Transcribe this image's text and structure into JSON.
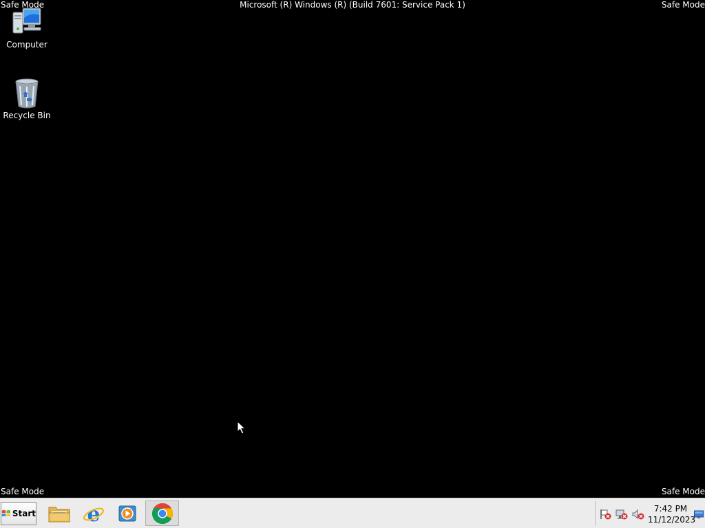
{
  "overlay": {
    "safe_mode": "Safe Mode",
    "build_info": "Microsoft (R) Windows (R) (Build 7601: Service Pack 1)"
  },
  "desktop_icons": [
    {
      "label": "Computer",
      "icon": "computer-icon"
    },
    {
      "label": "Recycle Bin",
      "icon": "recycle-bin-icon"
    }
  ],
  "taskbar": {
    "start_label": "Start",
    "pinned": [
      {
        "name": "Windows Explorer",
        "icon": "folder-icon"
      },
      {
        "name": "Internet Explorer",
        "icon": "internet-explorer-icon"
      },
      {
        "name": "Windows Media Player",
        "icon": "media-player-icon"
      },
      {
        "name": "Google Chrome",
        "icon": "chrome-icon"
      }
    ],
    "tray": {
      "icons": [
        "action-center-flag-icon",
        "network-icon",
        "volume-icon"
      ],
      "time": "7:42 PM",
      "date": "11/12/2023"
    }
  },
  "colors": {
    "desktop_bg": "#000000",
    "taskbar_bg": "#ececec",
    "overlay_text": "#ffffff",
    "error_red": "#d32f2f"
  }
}
